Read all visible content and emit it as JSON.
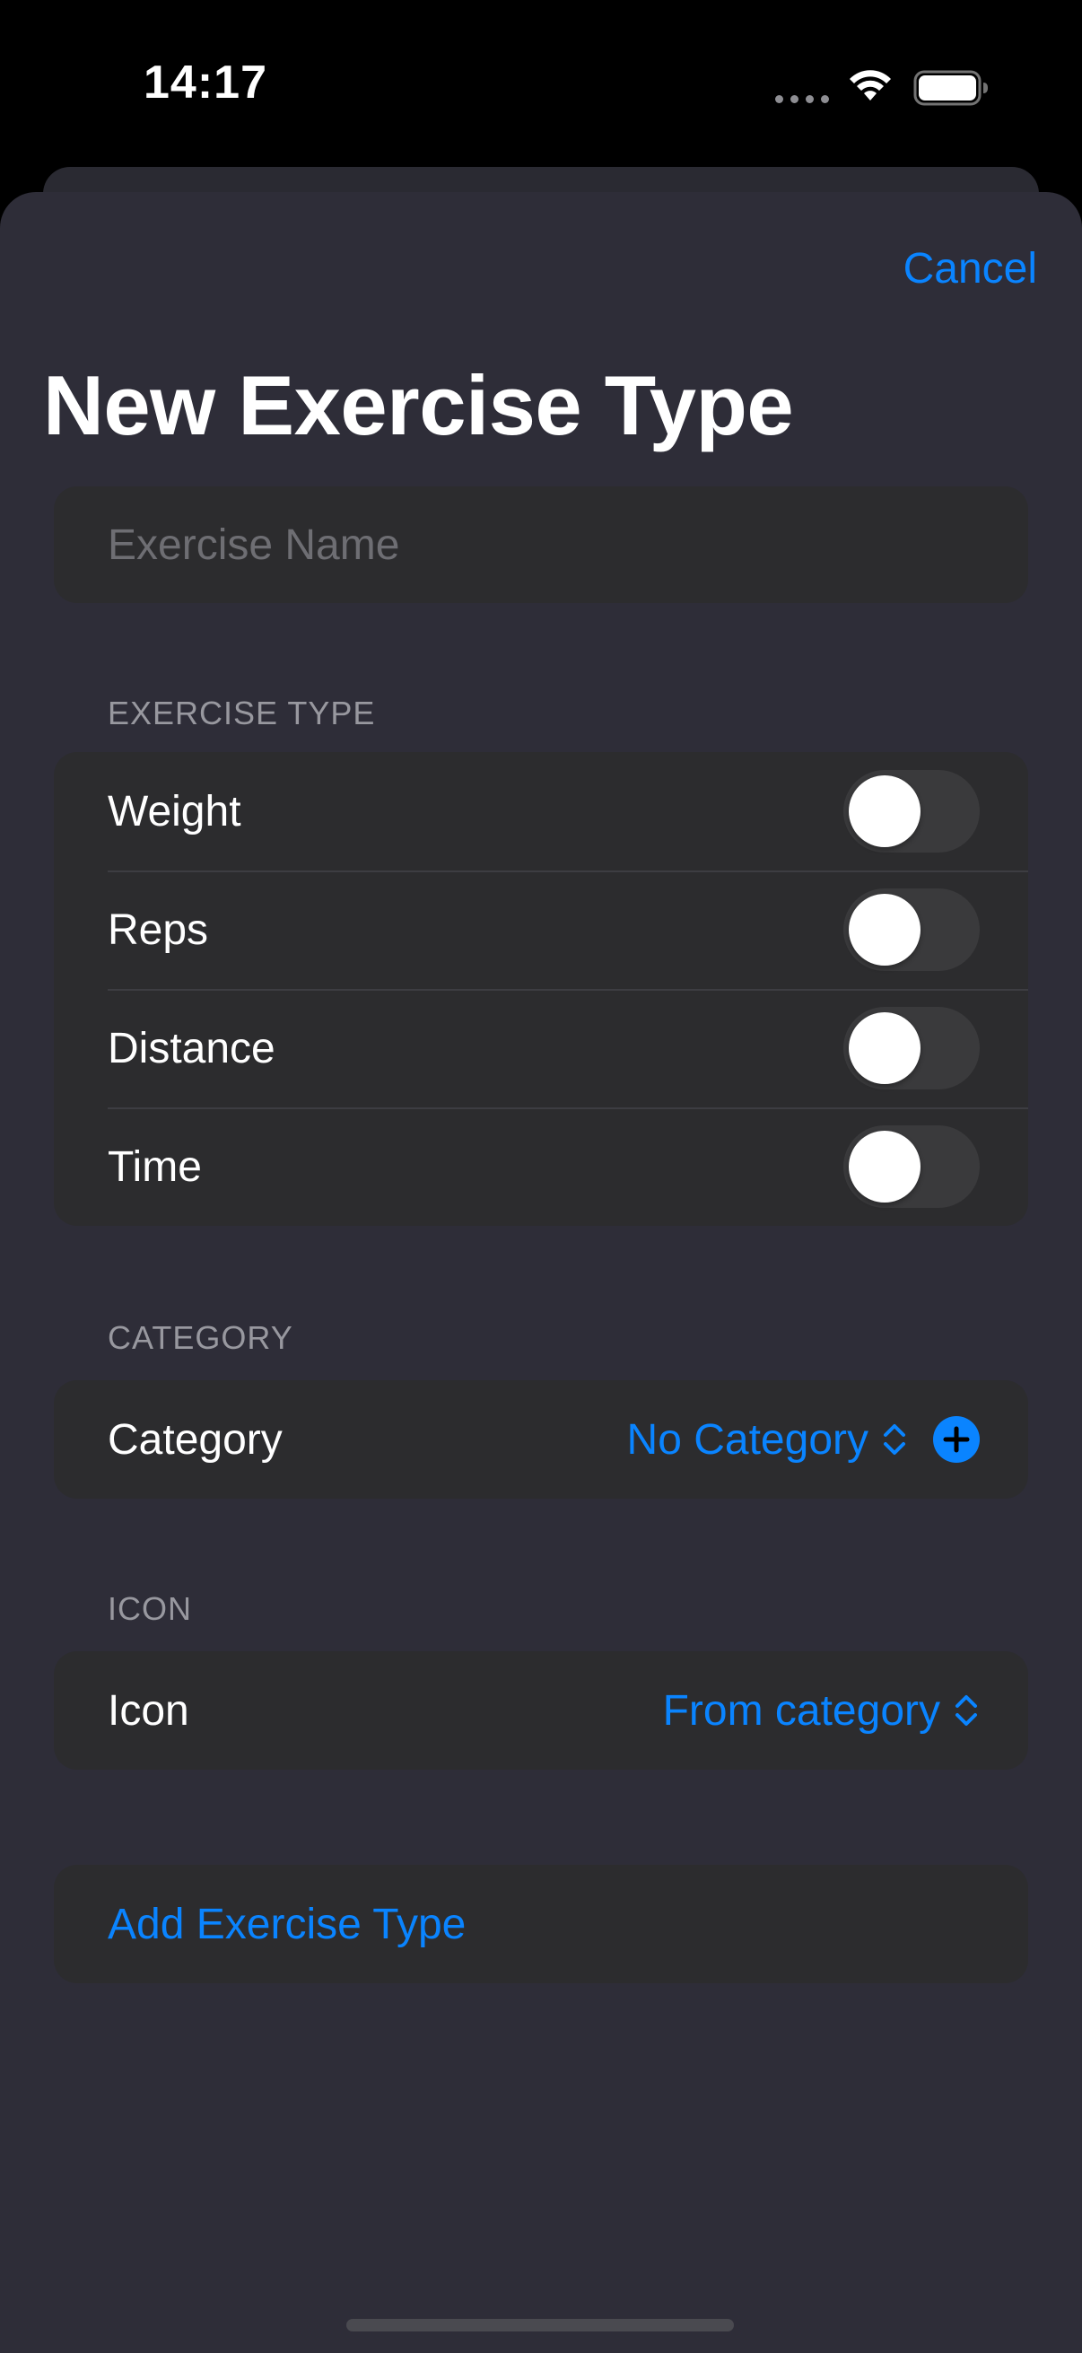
{
  "status_bar": {
    "time": "14:17"
  },
  "header": {
    "cancel_label": "Cancel",
    "title": "New Exercise Type"
  },
  "name_field": {
    "placeholder": "Exercise Name",
    "value": ""
  },
  "exercise_type": {
    "header": "EXERCISE TYPE",
    "toggles": [
      {
        "label": "Weight",
        "on": false
      },
      {
        "label": "Reps",
        "on": false
      },
      {
        "label": "Distance",
        "on": false
      },
      {
        "label": "Time",
        "on": false
      }
    ]
  },
  "category": {
    "header": "CATEGORY",
    "label": "Category",
    "value": "No Category"
  },
  "icon_section": {
    "header": "ICON",
    "label": "Icon",
    "value": "From category"
  },
  "actions": {
    "add_label": "Add Exercise Type"
  },
  "colors": {
    "accent": "#0a84ff",
    "sheet_background": "#2e2d38",
    "group_background": "#2c2c2e",
    "toggle_off": "#3a3a3c"
  },
  "icons": [
    "wifi-icon",
    "battery-icon",
    "chevron-updown-icon",
    "add-circle-icon"
  ]
}
